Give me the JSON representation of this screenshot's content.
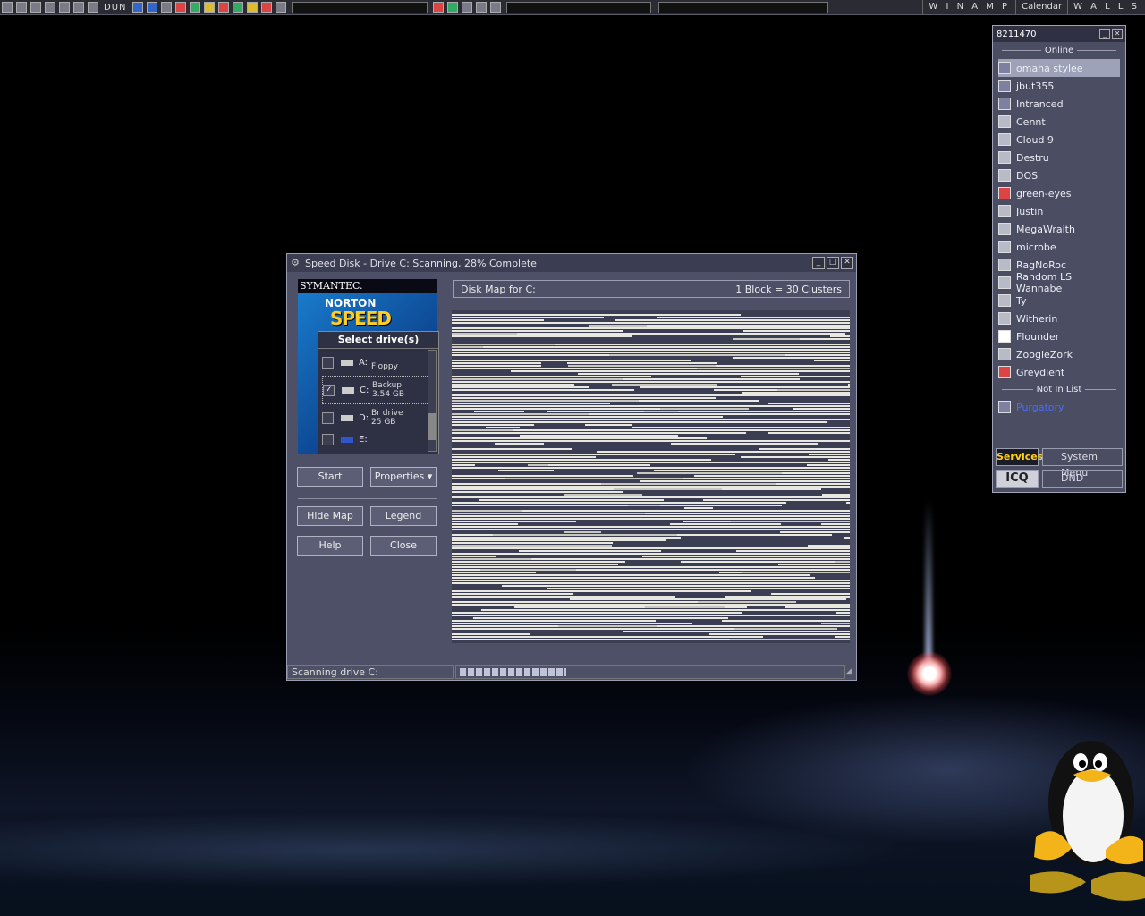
{
  "taskbar": {
    "dun_label": "DUN",
    "winamp_label": "W I N A M P",
    "calendar_label": "Calendar",
    "walls_label": "W A L L S"
  },
  "window": {
    "title": "Speed Disk - Drive C:  Scanning, 28% Complete",
    "brand": {
      "company": "SYMANTEC.",
      "product_line": "NORTON",
      "product": "SPEED DISK"
    },
    "select_drives_label": "Select drive(s)",
    "drives": [
      {
        "letter": "A:",
        "name": "",
        "size": "Floppy",
        "checked": false
      },
      {
        "letter": "C:",
        "name": "Backup",
        "size": "3.54 GB",
        "checked": true
      },
      {
        "letter": "D:",
        "name": "Br drive",
        "size": "25 GB",
        "checked": false
      },
      {
        "letter": "E:",
        "name": "",
        "size": "",
        "checked": false
      }
    ],
    "buttons": {
      "start": "Start",
      "properties": "Properties",
      "hide_map": "Hide Map",
      "legend": "Legend",
      "help": "Help",
      "close": "Close"
    },
    "map_title": "Disk Map for C:",
    "map_scale": "1 Block = 30 Clusters",
    "status_text": "Scanning drive C:",
    "progress_percent": 28
  },
  "icq": {
    "uin": "8211470",
    "online_header": "Online",
    "online": [
      {
        "name": "omaha stylee",
        "status": "group",
        "selected": true
      },
      {
        "name": "jbut355",
        "status": "group"
      },
      {
        "name": "Intranced",
        "status": "group"
      },
      {
        "name": "Cennt",
        "status": "online"
      },
      {
        "name": "Cloud 9",
        "status": "online"
      },
      {
        "name": "Destru",
        "status": "online"
      },
      {
        "name": "DOS",
        "status": "online"
      },
      {
        "name": "green-eyes",
        "status": "na"
      },
      {
        "name": "Justin",
        "status": "online"
      },
      {
        "name": "MegaWraith",
        "status": "online"
      },
      {
        "name": "microbe",
        "status": "online"
      },
      {
        "name": "RagNoRoc",
        "status": "online"
      },
      {
        "name": "Random LS Wannabe",
        "status": "online"
      },
      {
        "name": "Ty",
        "status": "online"
      },
      {
        "name": "Witherin",
        "status": "online"
      },
      {
        "name": "Flounder",
        "status": "ffc"
      },
      {
        "name": "ZoogieZork",
        "status": "online"
      },
      {
        "name": "Greydient",
        "status": "na"
      }
    ],
    "not_in_list_header": "Not In List",
    "not_in_list": [
      {
        "name": "Purgatory",
        "status": "group"
      }
    ],
    "buttons": {
      "services": "Services",
      "system_menu": "System Menu",
      "logo": "ICQ",
      "dnd": "DND"
    }
  }
}
